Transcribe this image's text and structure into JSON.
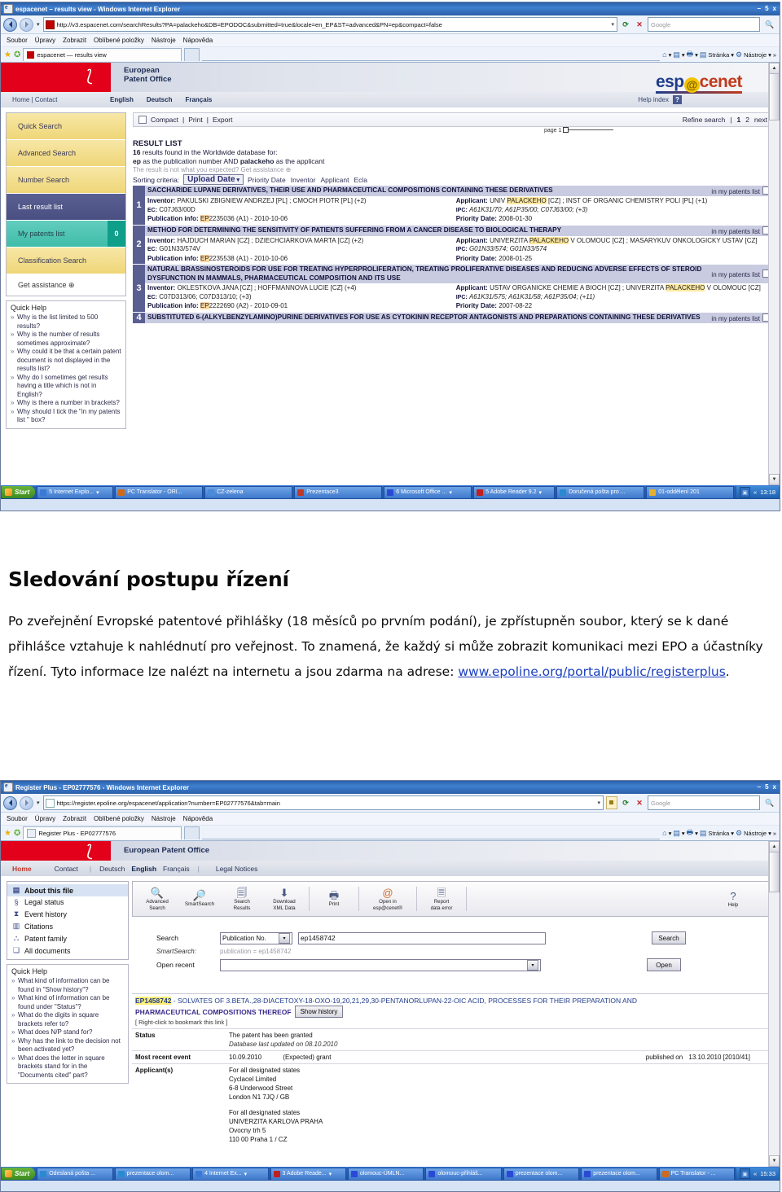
{
  "win1": {
    "title": "espacenet – results view - Windows Internet Explorer",
    "min": "–",
    "max": "5",
    "close": "x",
    "url": "http://v3.espacenet.com/searchResults?PA=palackeho&DB=EPODOC&submitted=true&locale=en_EP&ST=advanced&PN=ep&compact=false",
    "search_placeholder": "Google",
    "menus": [
      "Soubor",
      "Úpravy",
      "Zobrazit",
      "Oblíbené položky",
      "Nástroje",
      "Nápověda"
    ],
    "tab_label": "espacenet — results view",
    "fav_tools": [
      "Stránka",
      "Nástroje"
    ]
  },
  "epo": {
    "org_line1": "European",
    "org_line2": "Patent Office",
    "logo": {
      "part1": "esp",
      "at": "@",
      "part2": "cenet"
    },
    "nav_left": "Home | Contact",
    "langs": [
      "English",
      "Deutsch",
      "Français"
    ],
    "help_index": "Help index",
    "help_badge": "?",
    "sidebar": [
      {
        "label": "Quick Search",
        "style": "gold"
      },
      {
        "label": "Advanced Search",
        "style": "gold"
      },
      {
        "label": "Number Search",
        "style": "gold"
      },
      {
        "label": "Last result list",
        "style": "selected"
      },
      {
        "label": "My patents list",
        "style": "teal",
        "count": "0"
      },
      {
        "label": "Classification Search",
        "style": "gold"
      },
      {
        "label": "Get assistance ⊕",
        "style": "plain"
      }
    ],
    "quick_help": {
      "title": "Quick Help",
      "items": [
        "Why is the list limited to 500 results?",
        "Why is the number of results sometimes approximate?",
        "Why could it be that a certain patent document is not displayed in the results list?",
        "Why do I sometimes get results having a title which is not in English?",
        "Why is there a number in brackets?",
        "Why should I tick the \"in my patents list \" box?"
      ]
    },
    "toolbar": {
      "compact": "Compact",
      "print": "Print",
      "export": "Export",
      "refine": "Refine search",
      "page1": "1",
      "page2": "2",
      "next": "next",
      "page_label": "page 1"
    },
    "result_header": {
      "title": "RESULT LIST",
      "count": "16",
      "count_line_rest": " results found in the Worldwide database for:",
      "query_prefix": "ep",
      "query_mid": " as the publication number AND ",
      "query_term": "palackeho",
      "query_suffix": " as the applicant",
      "assist": "The result is not what you expected? Get assistance ⊕",
      "sorting_label": "Sorting criteria:",
      "sort_selected": "Upload Date",
      "sort_options": [
        "Priority Date",
        "Inventor",
        "Applicant",
        "Ecla"
      ]
    },
    "results": [
      {
        "num": "1",
        "title": "SACCHARIDE LUPANE DERIVATIVES, THEIR USE AND PHARMACEUTICAL COMPOSITIONS CONTAINING THESE DERIVATIVES",
        "mypatents": "in my patents list",
        "inventor_label": "Inventor:",
        "inventor": "PAKULSKI ZBIGNIEW ANDRZEJ [PL] ; CMOCH PIOTR [PL] (+2)",
        "ec_label": "EC:",
        "ec": "C07J63/00D",
        "pub_label": "Publication info:",
        "pub_code": "EP",
        "pub_rest": "2235036 (A1) - 2010-10-06",
        "applicant_label": "Applicant:",
        "applicant_pre": "UNIV ",
        "applicant_hl": "PALACKEHO",
        "applicant_post": " [CZ] ; INST OF ORGANIC CHEMISTRY POLI [PL] (+1)",
        "ipc_label": "IPC:",
        "ipc": "A61K31/70; A61P35/00; C07J63/00; (+3)",
        "prio_label": "Priority Date:",
        "prio": "2008-01-30"
      },
      {
        "num": "2",
        "title": "METHOD FOR DETERMINING THE SENSITIVITY OF PATIENTS SUFFERING FROM A CANCER DISEASE TO BIOLOGICAL THERAPY",
        "mypatents": "in my patents list",
        "inventor_label": "Inventor:",
        "inventor": "HAJDUCH MARIAN [CZ] ; DZIECHCIARKOVA MARTA [CZ] (+2)",
        "ec_label": "EC:",
        "ec": "G01N33/574V",
        "pub_label": "Publication info:",
        "pub_code": "EP",
        "pub_rest": "2235538 (A1) - 2010-10-06",
        "applicant_label": "Applicant:",
        "applicant_pre": "UNIVERZITA ",
        "applicant_hl": "PALACKEHO",
        "applicant_post": " V OLOMOUC [CZ] ; MASARYKUV ONKOLOGICKY USTAV [CZ]",
        "ipc_label": "IPC:",
        "ipc": "G01N33/574; G01N33/574",
        "prio_label": "Priority Date:",
        "prio": "2008-01-25"
      },
      {
        "num": "3",
        "title": "NATURAL BRASSINOSTEROIDS FOR USE FOR TREATING HYPERPROLIFERATION, TREATING PROLIFERATIVE DISEASES AND REDUCING ADVERSE EFFECTS OF STEROID DYSFUNCTION IN MAMMALS, PHARMACEUTICAL COMPOSITION AND ITS USE",
        "mypatents": "in my patents list",
        "inventor_label": "Inventor:",
        "inventor": "OKLESTKOVA JANA [CZ] ; HOFFMANNOVA LUCIE [CZ] (+4)",
        "ec_label": "EC:",
        "ec": "C07D313/06; C07D313/10; (+3)",
        "pub_label": "Publication info:",
        "pub_code": "EP",
        "pub_rest": "2222690 (A2) - 2010-09-01",
        "applicant_label": "Applicant:",
        "applicant_pre": "USTAV ORGANICKE CHEMIE A BIOCH [CZ] ; UNIVERZITA ",
        "applicant_hl": "PALACKEHO",
        "applicant_post": " V OLOMOUC [CZ]",
        "ipc_label": "IPC:",
        "ipc": "A61K31/575; A61K31/58; A61P35/04; (+11)",
        "prio_label": "Priority Date:",
        "prio": "2007-08-22"
      },
      {
        "num": "4",
        "title": "SUBSTITUTED 6-(ALKYLBENZYLAMINO)PURINE DERIVATIVES FOR USE AS CYTOKININ RECEPTOR ANTAGONISTS AND PREPARATIONS CONTAINING THESE DERIVATIVES",
        "mypatents": "in my patents list"
      }
    ]
  },
  "taskbar1": {
    "start": "Start",
    "items": [
      {
        "label": "5 Internet Explo...",
        "color": "#3a7ad6",
        "caret": true
      },
      {
        "label": "PC Translator - ORI...",
        "color": "#d06a1a",
        "caret": false
      },
      {
        "label": "CZ-zelena",
        "color": "#4a8ad6",
        "caret": false
      },
      {
        "label": "Prezentace3",
        "color": "#c03a2a",
        "caret": false
      },
      {
        "label": "6 Microsoft Office ...",
        "color": "#2a4ad6",
        "caret": true
      },
      {
        "label": "5 Adobe Reader 9.2",
        "color": "#c02020",
        "caret": true
      },
      {
        "label": "Doručená pošta pro ...",
        "color": "#2a8ad0",
        "caret": false
      },
      {
        "label": "01-oddělení 201",
        "color": "#e3b030",
        "caret": false
      }
    ],
    "tray_icon": "▣",
    "chevron": "«",
    "clock": "13:18"
  },
  "document": {
    "heading": "Sledování postupu řízení",
    "paragraph_1": "Po zveřejnění Evropské patentové přihlášky (18 měsíců po prvním podání), je zpřístupněn soubor, který se k dané přihlášce vztahuje k nahlédnutí pro veřejnost. To znamená, že každý si může zobrazit komunikaci mezi EPO a účastníky řízení. Tyto informace lze nalézt na internetu a jsou zdarma na adrese: ",
    "link_text": "www.epoline.org/portal/public/registerplus",
    "paragraph_end": "."
  },
  "win2": {
    "title": "Register Plus - EP02777576 - Windows Internet Explorer",
    "min": "–",
    "max": "5",
    "close": "x",
    "url": "https://register.epoline.org/espacenet/application?number=EP02777576&tab=main",
    "search_placeholder": "Google",
    "menus": [
      "Soubor",
      "Úpravy",
      "Zobrazit",
      "Oblíbené položky",
      "Nástroje",
      "Nápověda"
    ],
    "tab_label": "Register Plus - EP02777576",
    "fav_tools": [
      "Stránka",
      "Nástroje"
    ]
  },
  "rp": {
    "org": "European Patent Office",
    "nav": [
      "Home",
      "Contact",
      "Deutsch",
      "English",
      "Français",
      "Legal Notices"
    ],
    "sidebar": [
      {
        "icon": "▤",
        "label": "About this file",
        "selected": true
      },
      {
        "icon": "§",
        "label": "Legal status",
        "selected": false
      },
      {
        "icon": "⧗",
        "label": "Event history",
        "selected": false
      },
      {
        "icon": "▥",
        "label": "Citations",
        "selected": false
      },
      {
        "icon": "⛬",
        "label": "Patent family",
        "selected": false
      },
      {
        "icon": "❑",
        "label": "All documents",
        "selected": false
      }
    ],
    "quick_help": {
      "title": "Quick Help",
      "items": [
        "What kind of information can be found in \"Show history\"?",
        "What kind of information can be found under \"Status\"?",
        "What do the digits in square brackets refer to?",
        "What does N/P stand for?",
        "Why has the link to the decision not been activated yet?",
        "What does the letter in square brackets stand for in the \"Documents cited\" part?"
      ]
    },
    "toolbar": [
      {
        "icon": "🔍",
        "line1": "Advanced",
        "line2": "Search"
      },
      {
        "icon": "🔎",
        "line1": "SmartSearch",
        "line2": ""
      },
      {
        "icon": "🗐",
        "line1": "Search",
        "line2": "Results"
      },
      {
        "icon": "⬇",
        "line1": "Download",
        "line2": "XML Data"
      },
      {
        "icon": "🖶",
        "line1": "Print",
        "line2": ""
      },
      {
        "icon": "@",
        "line1": "Open in",
        "line2": "esp@cenet®"
      },
      {
        "icon": "🗏",
        "line1": "Report",
        "line2": "data error"
      }
    ],
    "help_btn": {
      "icon": "?",
      "label": "Help"
    },
    "form": {
      "search_label": "Search",
      "search_type": "Publication No.",
      "search_value": "ep1458742",
      "smartsearch_label": "SmartSearch:",
      "smartsearch_value": "publication = ep1458742",
      "open_recent_label": "Open recent",
      "open_recent_value": "",
      "search_button": "Search",
      "open_button": "Open"
    },
    "record": {
      "pub_code": "EP1458742",
      "title_part1": " - SOLVATES OF 3.BETA.,28-DIACETOXY-18-OXO-19,20,21,29,30-PENTANORLUPAN-22-OIC ACID, PROCESSES FOR THEIR PREPARATION AND",
      "title_part2": "PHARMACEUTICAL COMPOSITIONS THEREOF",
      "show_history": "Show history",
      "bookmark": "[ Right-click to bookmark this link ]",
      "rows": [
        {
          "key": "Status",
          "value": "The patent has been granted",
          "sub": "Database last updated on   08.10.2010"
        },
        {
          "key": "Most recent event",
          "date": "10.09.2010",
          "value": "(Expected) grant",
          "published_label": "published on",
          "published": "13.10.2010  [2010/41]"
        },
        {
          "key": "Applicant(s)",
          "lines": [
            "For all designated states",
            "Cyclacel Limited",
            "6-8 Underwood Street",
            "London N1 7JQ / GB",
            "",
            "For all designated states",
            "UNIVERZITA KARLOVA PRAHA",
            "Ovocny trh 5",
            "110 00 Praha 1 / CZ"
          ]
        }
      ]
    }
  },
  "taskbar2": {
    "start": "Start",
    "items": [
      {
        "label": "Odeslaná pošta ...",
        "color": "#2a8ad0",
        "caret": false
      },
      {
        "label": "prezentace olom...",
        "color": "#2a8ad0",
        "caret": false
      },
      {
        "label": "4 Internet Ex...",
        "color": "#3a7ad6",
        "caret": true
      },
      {
        "label": "3 Adobe Reade...",
        "color": "#c02020",
        "caret": true
      },
      {
        "label": "olomouc-ÚMLN...",
        "color": "#2a4ad6",
        "caret": false
      },
      {
        "label": "olomouc-přihláš...",
        "color": "#2a4ad6",
        "caret": false
      },
      {
        "label": "prezentace olom...",
        "color": "#2a4ad6",
        "caret": false
      },
      {
        "label": "prezentace olom...",
        "color": "#2a4ad6",
        "caret": false
      },
      {
        "label": "PC Translator - ...",
        "color": "#d06a1a",
        "caret": false
      }
    ],
    "tray_icon": "▣",
    "chevron": "«",
    "clock": "15:33"
  }
}
